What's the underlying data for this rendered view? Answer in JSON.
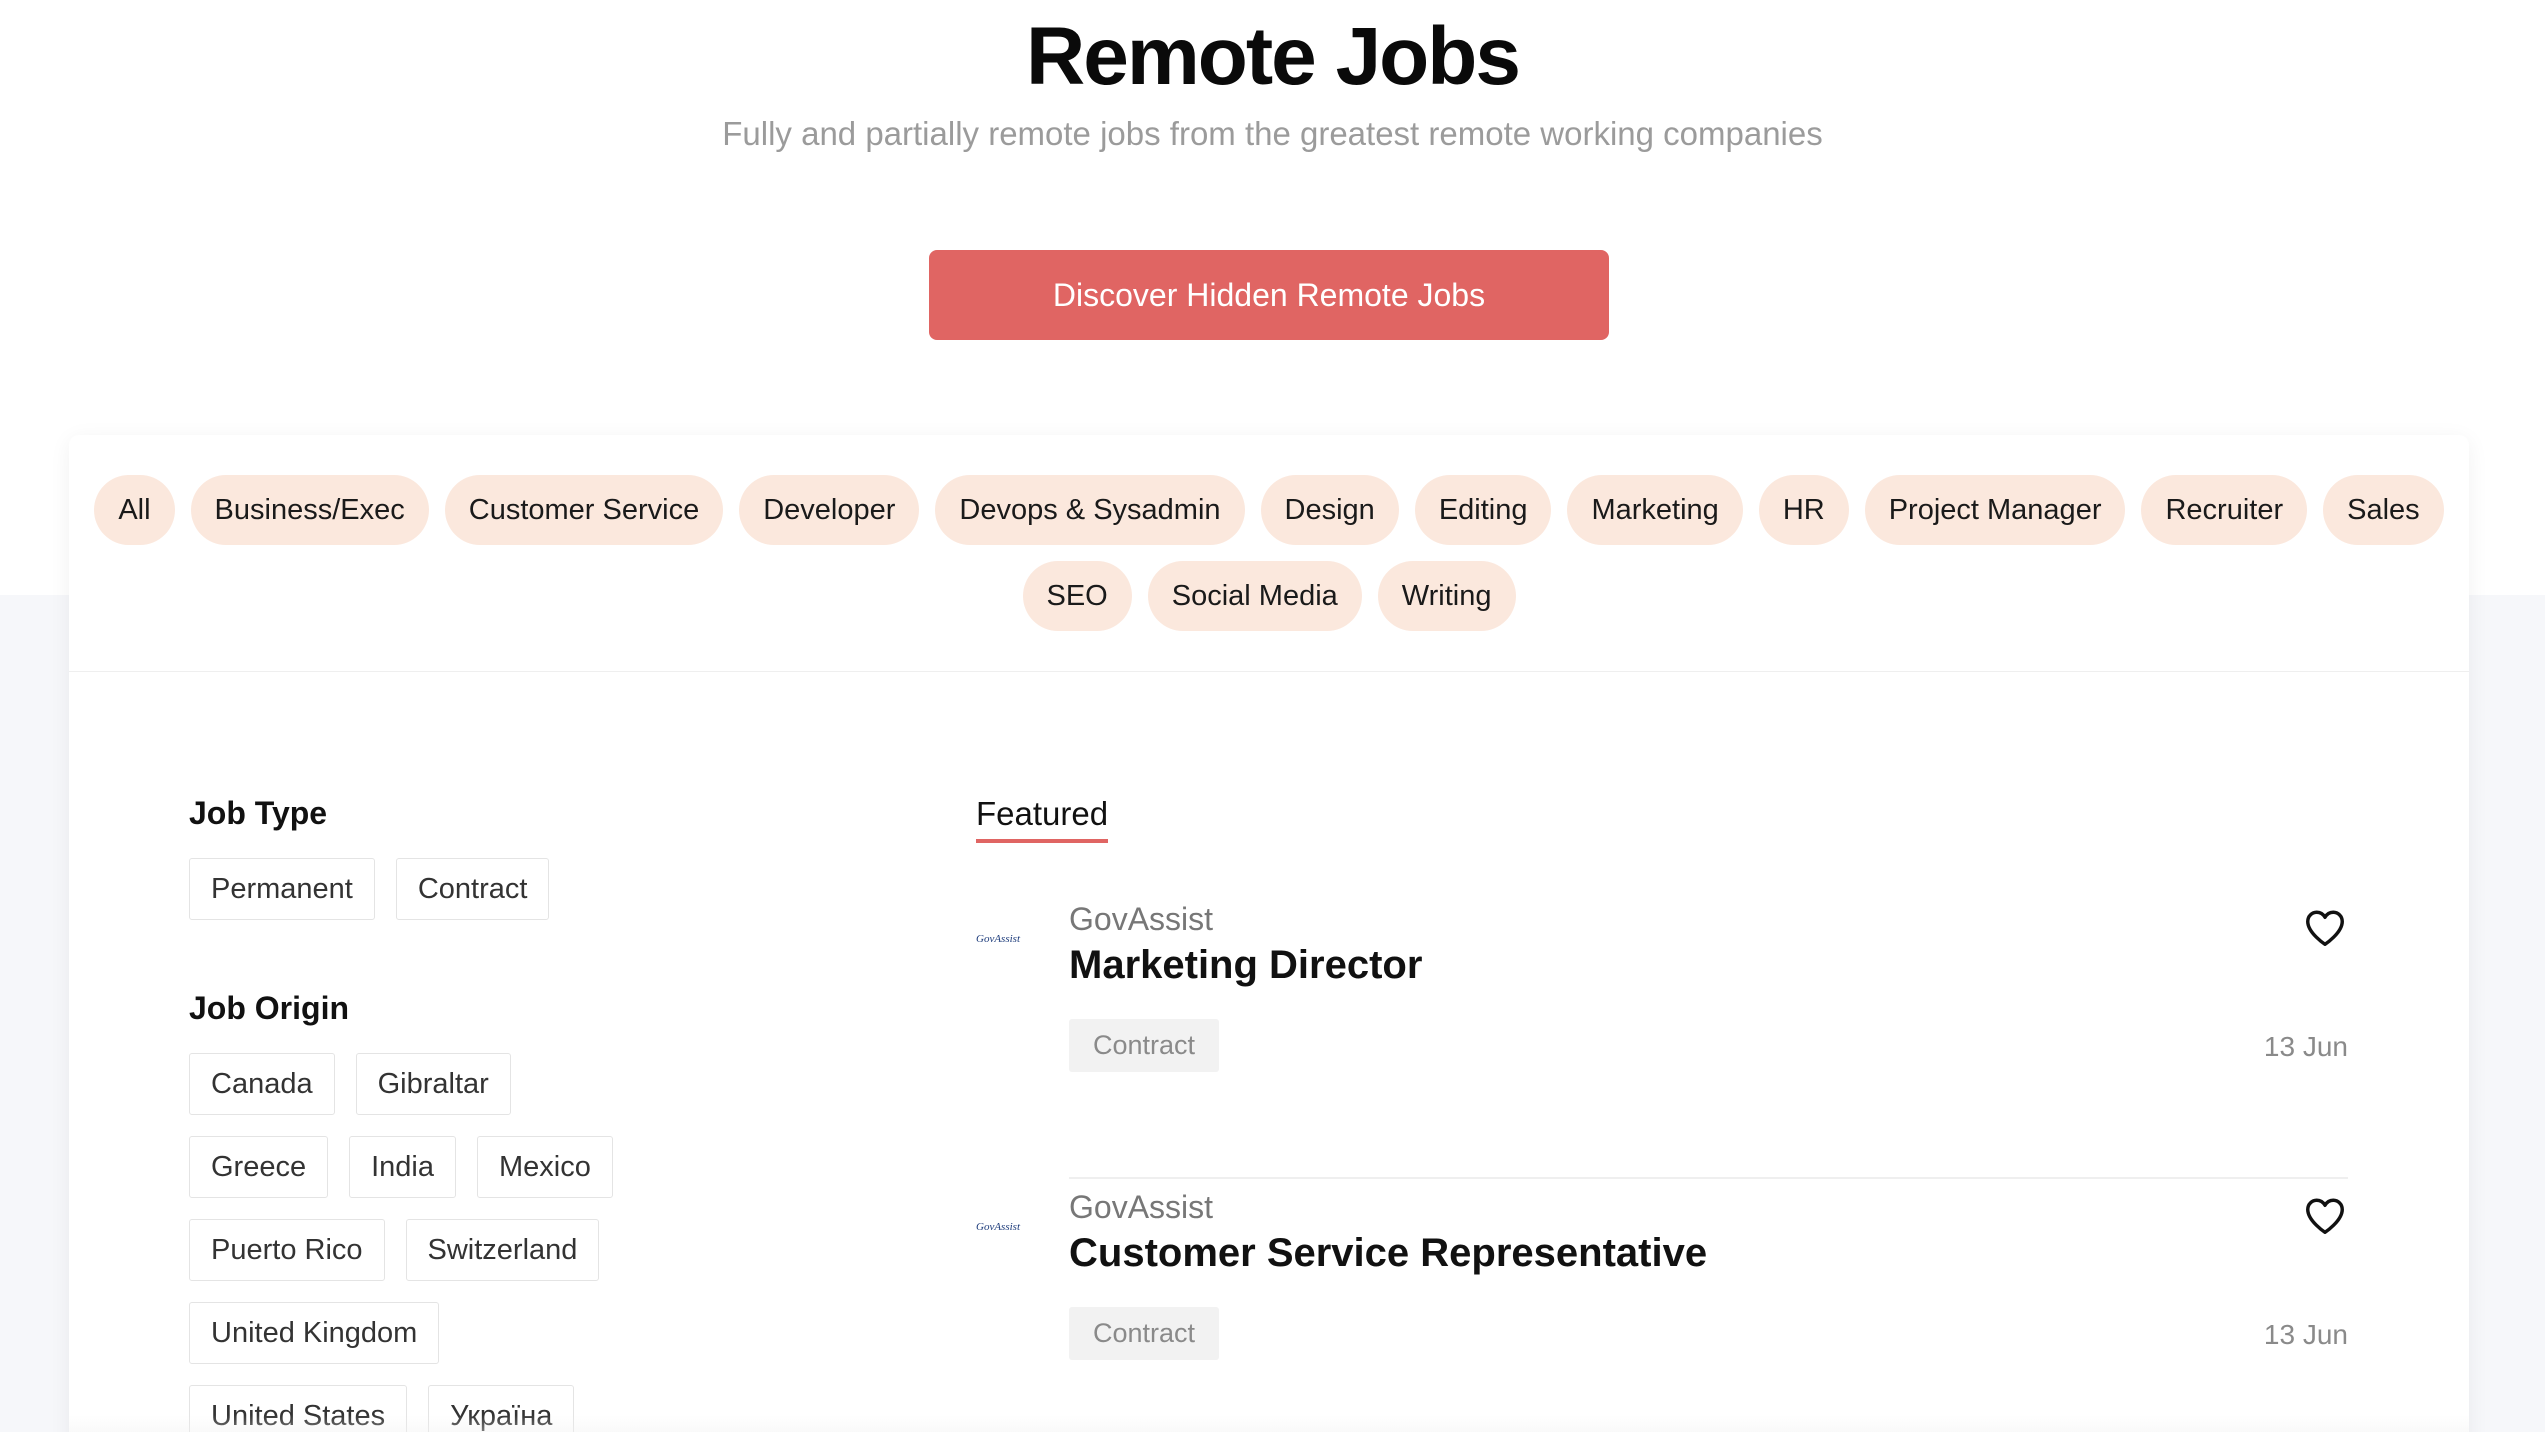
{
  "hero": {
    "title": "Remote Jobs",
    "subtitle": "Fully and partially remote jobs from the greatest remote working companies",
    "cta_label": "Discover Hidden Remote Jobs"
  },
  "categories": [
    "All",
    "Business/Exec",
    "Customer Service",
    "Developer",
    "Devops & Sysadmin",
    "Design",
    "Editing",
    "Marketing",
    "HR",
    "Project Manager",
    "Recruiter",
    "Sales",
    "SEO",
    "Social Media",
    "Writing"
  ],
  "filters": {
    "job_type": {
      "heading": "Job Type",
      "options": [
        "Permanent",
        "Contract"
      ]
    },
    "job_origin": {
      "heading": "Job Origin",
      "options": [
        "Canada",
        "Gibraltar",
        "Greece",
        "India",
        "Mexico",
        "Puerto Rico",
        "Switzerland",
        "United Kingdom",
        "United States",
        "Україна"
      ]
    }
  },
  "jobs_tab": "Featured",
  "jobs": [
    {
      "logo_text": "GovAssist",
      "company": "GovAssist",
      "title": "Marketing Director",
      "tag": "Contract",
      "date": "13 Jun",
      "icon": "heart-outline-icon"
    },
    {
      "logo_text": "GovAssist",
      "company": "GovAssist",
      "title": "Customer Service Representative",
      "tag": "Contract",
      "date": "13 Jun",
      "icon": "heart-outline-icon"
    }
  ],
  "colors": {
    "accent": "#e06563",
    "category_bg": "#fbe8dd",
    "page_bg_lower": "#f6f7fa"
  }
}
